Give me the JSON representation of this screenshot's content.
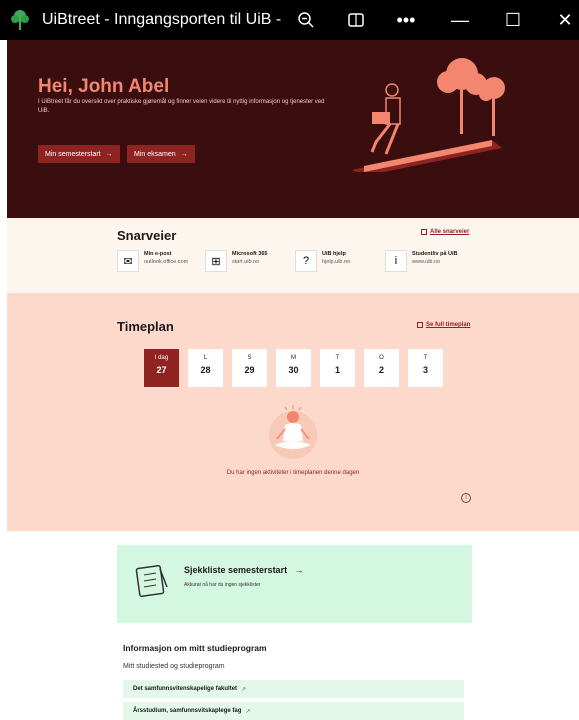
{
  "window": {
    "title": "UiBtreet - Inngangsporten til UiB -...",
    "zoom_icon": "zoom-out-icon",
    "reader_icon": "reader-icon",
    "more_label": "•••",
    "minimize_label": "—",
    "maximize_label": "☐",
    "close_label": "✕"
  },
  "hero": {
    "greeting": "Hei, John Abel",
    "description": "I UiBtreet får du oversikt over praktiske gjøremål og finner veien videre til nyttig informasjon og tjenester ved UiB.",
    "buttons": [
      {
        "label": "Min semesterstart",
        "arrow": "→"
      },
      {
        "label": "Min eksamen",
        "arrow": "→"
      }
    ]
  },
  "shortcuts": {
    "title": "Snarveier",
    "all_link": "Alle snarveier",
    "items": [
      {
        "name": "Min e-post",
        "sub": "outlook.office.com",
        "icon": "mail-icon",
        "glyph": "✉"
      },
      {
        "name": "Microsoft 365",
        "sub": "start.uib.no",
        "icon": "windows-icon",
        "glyph": "⊞"
      },
      {
        "name": "UiB hjelp",
        "sub": "hjelp.uib.no",
        "icon": "help-icon",
        "glyph": "?"
      },
      {
        "name": "Studentliv på UiB",
        "sub": "www.uib.no",
        "icon": "info-icon",
        "glyph": "i"
      }
    ]
  },
  "timeplan": {
    "title": "Timeplan",
    "full_link": "Se full timeplan",
    "days": [
      {
        "label": "I dag",
        "num": "27"
      },
      {
        "label": "L",
        "num": "28"
      },
      {
        "label": "S",
        "num": "29"
      },
      {
        "label": "M",
        "num": "30"
      },
      {
        "label": "T",
        "num": "1"
      },
      {
        "label": "O",
        "num": "2"
      },
      {
        "label": "T",
        "num": "3"
      }
    ],
    "empty_text": "Du har ingen aktiviteter i timeplanen denne dagen",
    "info_glyph": "i"
  },
  "checklist": {
    "title": "Sjekkliste semesterstart",
    "arrow": "→",
    "sub": "Akkurat nå har du ingen sjekklister"
  },
  "studyprogram": {
    "title": "Informasjon om mitt studieprogram",
    "subtitle": "Mitt studiested og studieprogram",
    "items": [
      {
        "label": "Det samfunnsvitenskapelige fakultet",
        "ext": "↗"
      },
      {
        "label": "Årsstudium, samfunnsvitskaplege fag",
        "ext": "↗"
      }
    ]
  },
  "colors": {
    "hero_bg": "#3a0d0e",
    "accent": "#8f2322",
    "greeting": "#f2866f",
    "timeplan_bg": "#fdd9cc",
    "checklist_bg": "#d4f7e2"
  }
}
